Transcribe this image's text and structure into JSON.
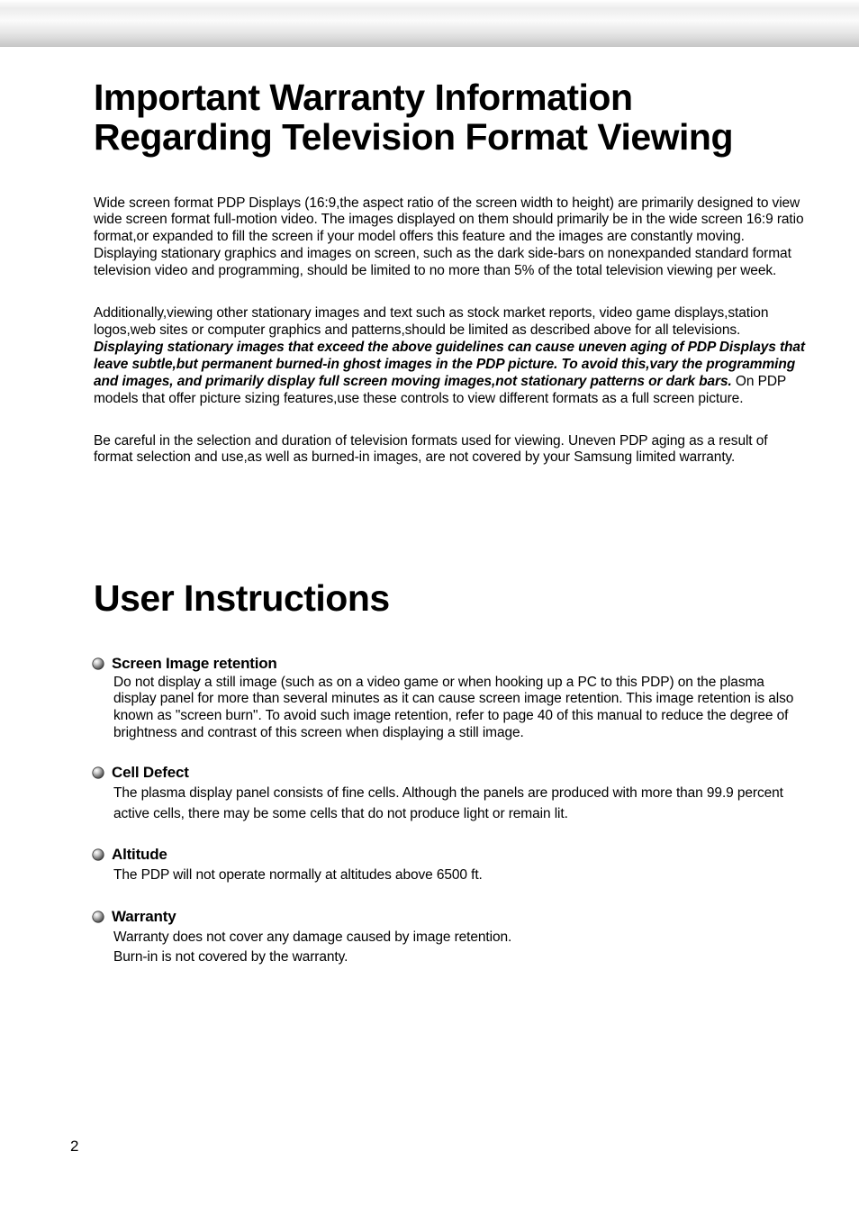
{
  "heading1_line1": "Important Warranty Information",
  "heading1_line2": "Regarding Television Format Viewing",
  "para1": "Wide screen format PDP Displays (16:9,the aspect ratio of the screen width to height) are primarily designed to view wide screen format full-motion video. The images displayed on them should primarily be in the wide screen 16:9 ratio format,or expanded to fill the screen if your model offers this feature and the images are constantly moving. Displaying stationary graphics and images on screen, such as the dark side-bars on nonexpanded standard format television video and programming, should be limited to no more than 5% of the total television viewing per week.",
  "para2_pre": "Additionally,viewing other stationary images and text such as stock market reports, video game displays,station logos,web sites or computer graphics and patterns,should be limited as described above for all televisions. ",
  "para2_bold": "Displaying stationary images that exceed the above guidelines can cause uneven aging of PDP Displays that leave subtle,but permanent burned-in ghost images in the PDP picture. To avoid this,vary the programming and images, and primarily display full screen moving images,not stationary patterns or dark bars.",
  "para2_post": " On PDP models that offer picture sizing features,use these controls to view different formats as a full screen picture.",
  "para3": "Be careful in the selection and duration of television formats used for viewing. Uneven PDP aging as a result of format selection and use,as well as burned-in images, are not covered by your Samsung limited warranty.",
  "heading2": "User Instructions",
  "sections": [
    {
      "title": "Screen Image retention",
      "body": "Do not display a still image (such as on a video game or when hooking up a PC to this PDP) on the plasma display panel for more than several minutes as  it can cause screen image retention. This image retention is also known as \"screen burn\". To avoid such image retention, refer to page 40 of this manual to reduce the degree of brightness and contrast of this screen when displaying a still image.",
      "tight": true
    },
    {
      "title": "Cell Defect",
      "body": "The plasma display panel consists of fine cells. Although the panels are produced with more than 99.9 percent active cells, there may be some cells that do not produce light or remain lit.",
      "tight": false
    },
    {
      "title": "Altitude",
      "body": "The PDP will not operate normally at altitudes above 6500 ft.",
      "tight": false
    },
    {
      "title": "Warranty",
      "body": "Warranty does not cover any damage caused by image retention.\nBurn-in is not covered by the warranty.",
      "tight": false
    }
  ],
  "page_number": "2"
}
